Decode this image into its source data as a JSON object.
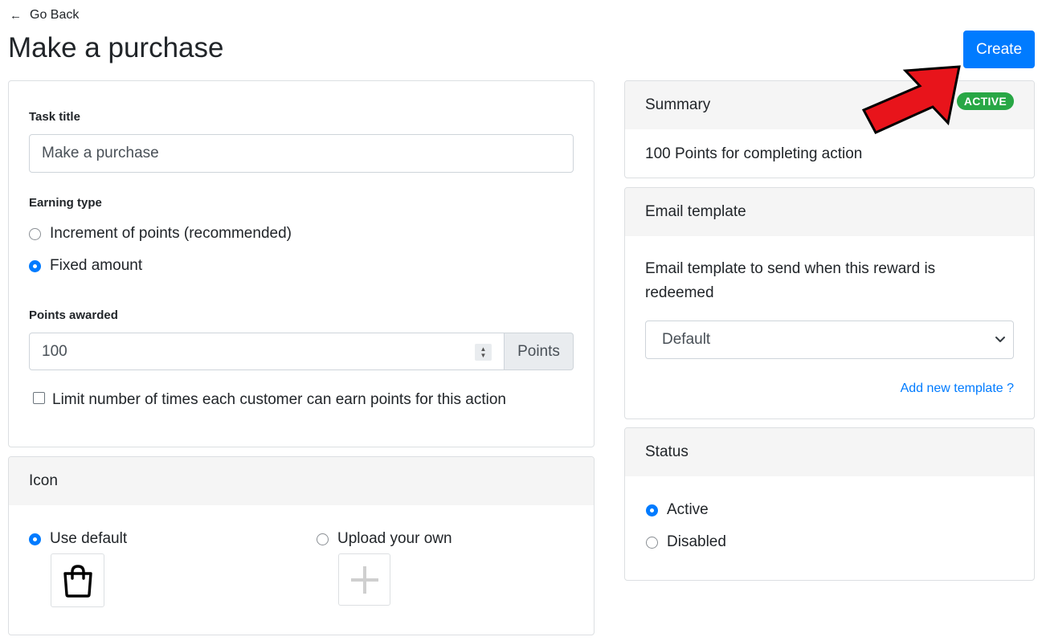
{
  "nav": {
    "back_arrow": "←",
    "back_label": "Go Back"
  },
  "page": {
    "title": "Make a purchase",
    "create_label": "Create"
  },
  "task": {
    "title_label": "Task title",
    "title_value": "Make a purchase",
    "earning_type_label": "Earning type",
    "earning_options": [
      {
        "label": "Increment of points (recommended)",
        "selected": false
      },
      {
        "label": "Fixed amount",
        "selected": true
      }
    ],
    "points_label": "Points awarded",
    "points_value": "100",
    "points_unit": "Points",
    "limit_label": "Limit number of times each customer can earn points for this action",
    "limit_checked": false
  },
  "icon_card": {
    "header": "Icon",
    "use_default_label": "Use default",
    "use_default_selected": true,
    "default_icon": "shopping-bag-icon",
    "upload_label": "Upload your own",
    "upload_selected": false,
    "upload_icon": "plus-icon"
  },
  "summary": {
    "header": "Summary",
    "badge": "ACTIVE",
    "text": "100 Points for completing action"
  },
  "email": {
    "header": "Email template",
    "description": "Email template to send when this reward is redeemed",
    "select_value": "Default",
    "add_link": "Add new template ?"
  },
  "status": {
    "header": "Status",
    "options": [
      {
        "label": "Active",
        "selected": true
      },
      {
        "label": "Disabled",
        "selected": false
      }
    ]
  },
  "colors": {
    "primary": "#007bff",
    "success": "#28a745",
    "annotation": "#e8141b"
  }
}
